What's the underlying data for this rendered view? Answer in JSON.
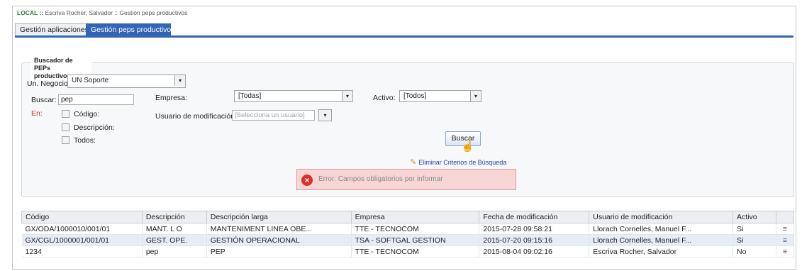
{
  "breadcrumb": {
    "env": "LOCAL",
    "sep1": " :: ",
    "user": "Escriva Rocher, Salvador",
    "sep2": " :: ",
    "section": "Gestión peps productivos"
  },
  "tabs": [
    {
      "label": "Gestión aplicaciones"
    },
    {
      "label": "Gestión peps productivos"
    }
  ],
  "search_panel": {
    "legend": "Buscador de PEPs productivos",
    "unit_label": "Un. Negocio:",
    "unit_value": "UN Soporte",
    "search_label": "Buscar:",
    "search_value": "pep",
    "in_label": "En:",
    "checkboxes": [
      {
        "label": "Código:"
      },
      {
        "label": "Descripción:"
      },
      {
        "label": "Todos:"
      }
    ],
    "company_label": "Empresa:",
    "company_value": "[Todas]",
    "active_label": "Activo:",
    "active_value": "[Todos]",
    "mod_user_label": "Usuario de modificación:",
    "mod_user_placeholder": "[Selecciona un usuario]",
    "search_button": "Buscar",
    "clear_link": "Eliminar Criterios de Búsqueda",
    "error": "Error: Campos obligatorios por informar"
  },
  "table": {
    "headers": [
      "Código",
      "Descripción",
      "Descripción larga",
      "Empresa",
      "Fecha de modificación",
      "Usuario de modificación",
      "Activo",
      ""
    ],
    "rows": [
      {
        "codigo": "GX/ODA/1000010/001/01",
        "descripcion": "MANT. L O",
        "larga": "MANTENIMENT LINEA OBE...",
        "empresa": "TTE - TECNOCOM",
        "fecha": "2015-07-28 09:58:21",
        "usuario": "Llorach Cornelles, Manuel F...",
        "activo": "Si"
      },
      {
        "codigo": "GX/CGL/1000001/001/01",
        "descripcion": "GEST. OPE.",
        "larga": "GESTIÓN OPERACIONAL",
        "empresa": "TSA - SOFTGAL GESTION",
        "fecha": "2015-07-20 09:15:16",
        "usuario": "Llorach Cornelles, Manuel F...",
        "activo": "Si"
      },
      {
        "codigo": "1234",
        "descripcion": "pep",
        "larga": "PEP",
        "empresa": "TTE - TECNOCOM",
        "fecha": "2015-08-04 09:02:16",
        "usuario": "Escriva Rocher, Salvador",
        "activo": "No"
      }
    ]
  },
  "icons": {
    "dropdown": "▾",
    "row_menu": "≡",
    "error": "×",
    "clear": "✎",
    "cursor": "☝"
  }
}
